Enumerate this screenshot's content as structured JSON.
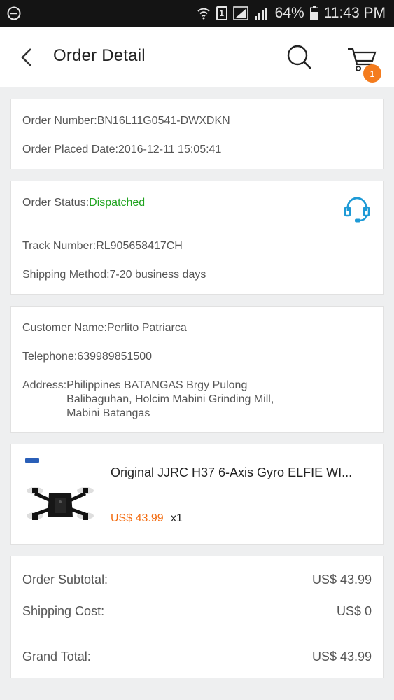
{
  "status_bar": {
    "battery": "64%",
    "time": "11:43 PM",
    "sim_label": "1"
  },
  "header": {
    "title": "Order Detail",
    "cart_count": "1"
  },
  "order": {
    "number_label": "Order Number:",
    "number_value": "BN16L11G0541-DWXDKN",
    "date_label": "Order Placed Date:",
    "date_value": "2016-12-11 15:05:41"
  },
  "status": {
    "status_label": "Order Status:",
    "status_value": "Dispatched",
    "status_color": "#1fa31f",
    "track_label": "Track Number:",
    "track_value": "RL905658417CH",
    "shipping_label": "Shipping Method:",
    "shipping_value": "7-20 business days",
    "support_icon": "headset-icon"
  },
  "customer": {
    "name_label": "Customer Name:",
    "name_value": "Perlito Patriarca",
    "phone_label": "Telephone:",
    "phone_value": "639989851500",
    "address_label": "Address:",
    "address_lines": [
      "Philippines BATANGAS Brgy Pulong",
      "Balibaguhan, Holcim Mabini Grinding Mill,",
      "Mabini Batangas"
    ]
  },
  "product": {
    "name": "Original JJRC H37 6-Axis Gyro ELFIE WI...",
    "price": "US$ 43.99",
    "quantity": "x1",
    "price_color": "#f36b10"
  },
  "summary": {
    "subtotal_label": "Order Subtotal:",
    "subtotal_value": "US$ 43.99",
    "shipping_label": "Shipping Cost:",
    "shipping_value": "US$ 0",
    "total_label": "Grand Total:",
    "total_value": "US$ 43.99",
    "accent_color": "#f36b10"
  }
}
